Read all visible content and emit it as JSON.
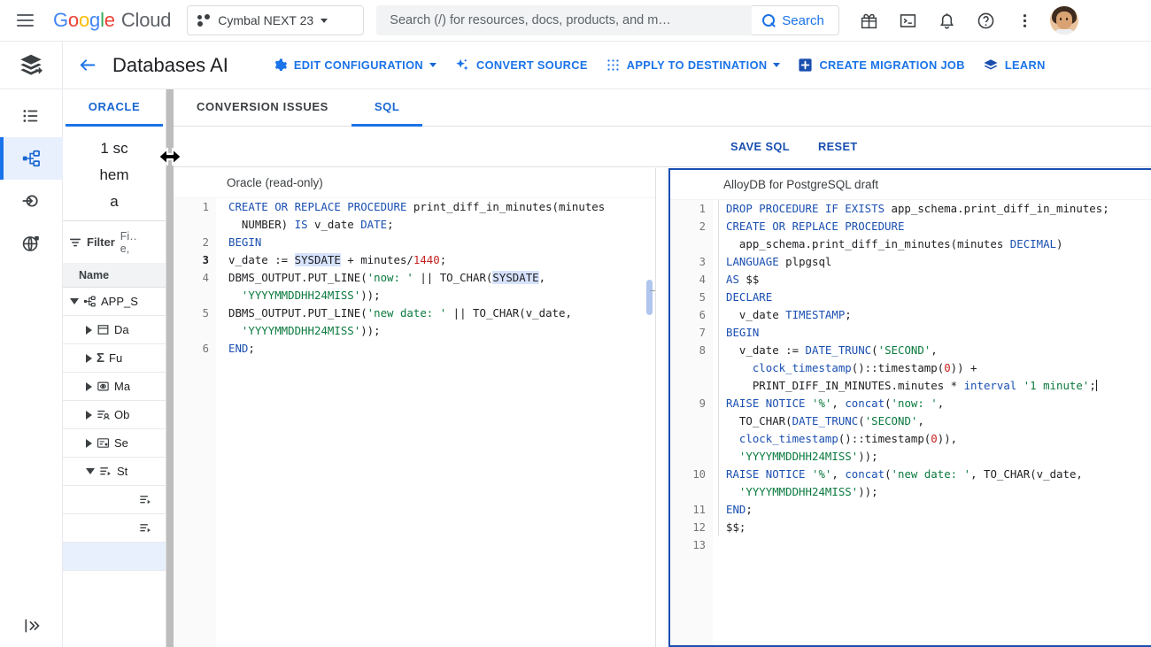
{
  "topbar": {
    "menu_icon": "hamburger-menu-icon",
    "brand": {
      "g": "G",
      "o1": "o",
      "o2": "o",
      "g2": "g",
      "l": "l",
      "e": "e",
      "cloud": "Cloud"
    },
    "project": {
      "label": "Cymbal NEXT 23",
      "icon": "project-dots-icon",
      "caret": "chevron-down-icon"
    },
    "search": {
      "placeholder": "Search (/) for resources, docs, products, and m…",
      "button_label": "Search",
      "icon": "search-icon"
    },
    "icons": [
      {
        "name": "gift-icon",
        "title": "Gift"
      },
      {
        "name": "cloud-shell-terminal-icon",
        "title": "Activate Cloud Shell"
      },
      {
        "name": "notifications-bell-icon",
        "title": "Notifications"
      },
      {
        "name": "help-question-icon",
        "title": "Help"
      },
      {
        "name": "more-vert-icon",
        "title": "More options"
      }
    ],
    "avatar": "user-avatar"
  },
  "pageheader": {
    "product_icon": "database-migration-stack-icon",
    "back_icon": "back-arrow-icon",
    "title": "Databases AI",
    "buttons": [
      {
        "label": "EDIT CONFIGURATION",
        "icon": "gear-icon",
        "caret": true
      },
      {
        "label": "CONVERT SOURCE",
        "icon": "sparkle-icon",
        "caret": false
      },
      {
        "label": "APPLY TO DESTINATION",
        "icon": "grid-dots-icon",
        "caret": true
      },
      {
        "label": "CREATE MIGRATION JOB",
        "icon": "plus-box-icon",
        "caret": false
      },
      {
        "label": "LEARN",
        "icon": "learn-stack-icon",
        "caret": false
      }
    ]
  },
  "rail": {
    "items": [
      {
        "name": "sidebar-item-list",
        "icon": "list-bullet-icon",
        "active": false
      },
      {
        "name": "sidebar-item-schema",
        "icon": "schema-tree-icon",
        "active": true
      },
      {
        "name": "sidebar-item-connection",
        "icon": "connection-arrow-icon",
        "active": false
      },
      {
        "name": "sidebar-item-global",
        "icon": "globe-icon",
        "active": false
      }
    ],
    "expand_icon": "expand-panel-icon"
  },
  "explorer": {
    "tab_label": "ORACLE",
    "schema_count": "1 schema",
    "filter_label": "Filter",
    "filter_placeholder": "Fi… e,",
    "column_header": "Name",
    "tree": [
      {
        "label": "APP_S",
        "icon": "schema-tree-icon",
        "twisty": "open",
        "indent": 0,
        "selected": false
      },
      {
        "label": "Da",
        "icon": "database-table-icon",
        "twisty": "closed",
        "indent": 1,
        "selected": false
      },
      {
        "label": "Fu",
        "icon": "sigma-function-icon",
        "twisty": "closed",
        "indent": 1,
        "selected": false
      },
      {
        "label": "Ma",
        "icon": "materialized-view-eye-icon",
        "twisty": "closed",
        "indent": 1,
        "selected": false
      },
      {
        "label": "Ob",
        "icon": "object-type-icon",
        "twisty": "closed",
        "indent": 1,
        "selected": false
      },
      {
        "label": "Se",
        "icon": "sequence-icon",
        "twisty": "closed",
        "indent": 1,
        "selected": false
      },
      {
        "label": "St",
        "icon": "stored-procedure-icon",
        "twisty": "open",
        "indent": 1,
        "selected": false
      },
      {
        "label": "",
        "icon": "stored-procedure-icon",
        "twisty": "none",
        "indent": 2,
        "selected": false
      },
      {
        "label": "",
        "icon": "stored-procedure-icon",
        "twisty": "none",
        "indent": 2,
        "selected": false
      },
      {
        "label": "",
        "icon": "none",
        "twisty": "none",
        "indent": 2,
        "selected": true
      }
    ]
  },
  "workspace": {
    "tabs": [
      {
        "label": "CONVERSION ISSUES",
        "active": false
      },
      {
        "label": "SQL",
        "active": true
      }
    ],
    "actions": [
      {
        "label": "SAVE SQL"
      },
      {
        "label": "RESET"
      }
    ]
  },
  "oracle_editor": {
    "header": "Oracle (read-only)",
    "lines": [
      {
        "n": "1",
        "bold": false,
        "html": "<span class='kw'>CREATE OR REPLACE PROCEDURE</span> print_diff_in_minutes(minutes\n  NUMBER) <span class='kw'>IS</span> v_date <span class='kw'>DATE</span>;"
      },
      {
        "n": "2",
        "bold": false,
        "html": "<span class='kw'>BEGIN</span>"
      },
      {
        "n": "3",
        "bold": true,
        "html": "v_date := <span class='hl'>SYSDATE</span> + minutes/<span class='num'>1440</span>;"
      },
      {
        "n": "4",
        "bold": false,
        "html": "DBMS_OUTPUT.PUT_LINE(<span class='str'>'now: '</span> || TO_CHAR(<span class='hl'>SYSDATE</span>,\n  <span class='str'>'YYYYMMDDHH24MISS'</span>));"
      },
      {
        "n": "5",
        "bold": false,
        "html": "DBMS_OUTPUT.PUT_LINE(<span class='str'>'new date: '</span> || TO_CHAR(v_date,\n  <span class='str'>'YYYYMMDDHH24MISS'</span>));"
      },
      {
        "n": "6",
        "bold": false,
        "html": "<span class='kw'>END</span>;"
      }
    ],
    "plain_text": "CREATE OR REPLACE PROCEDURE print_diff_in_minutes(minutes NUMBER) IS v_date DATE;\nBEGIN\nv_date := SYSDATE + minutes/1440;\nDBMS_OUTPUT.PUT_LINE('now: ' || TO_CHAR(SYSDATE, 'YYYYMMDDHH24MISS'));\nDBMS_OUTPUT.PUT_LINE('new date: ' || TO_CHAR(v_date, 'YYYYMMDDHH24MISS'));\nEND;"
  },
  "postgres_editor": {
    "header": "AlloyDB for PostgreSQL draft",
    "lines": [
      {
        "n": "1",
        "html": "<span class='kw'>DROP PROCEDURE IF EXISTS</span> app_schema.print_diff_in_minutes;"
      },
      {
        "n": "2",
        "html": "<span class='kw'>CREATE OR REPLACE PROCEDURE</span>\n  app_schema.print_diff_in_minutes(minutes <span class='kw'>DECIMAL</span>)"
      },
      {
        "n": "3",
        "html": "<span class='kw'>LANGUAGE</span> plpgsql"
      },
      {
        "n": "4",
        "html": "<span class='kw'>AS</span> $$"
      },
      {
        "n": "5",
        "html": "<span class='kw'>DECLARE</span>"
      },
      {
        "n": "6",
        "html": "  v_date <span class='kw'>TIMESTAMP</span>;"
      },
      {
        "n": "7",
        "html": "<span class='kw'>BEGIN</span>"
      },
      {
        "n": "8",
        "html": "  v_date := <span class='fn'>DATE_TRUNC</span>(<span class='str'>'SECOND'</span>,\n    <span class='fn'>clock_timestamp</span>()::timestamp(<span class='num'>0</span>)) +\n    PRINT_DIFF_IN_MINUTES.minutes * <span class='kw'>interval</span> <span class='str'>'1 minute'</span>;<span class='cursorbar'></span>"
      },
      {
        "n": "9",
        "html": "<span class='kw'>RAISE NOTICE</span> <span class='str'>'%'</span>, <span class='fn'>concat</span>(<span class='str'>'now: '</span>,\n  TO_CHAR(<span class='fn'>DATE_TRUNC</span>(<span class='str'>'SECOND'</span>,\n  <span class='fn'>clock_timestamp</span>()::timestamp(<span class='num'>0</span>)),\n  <span class='str'>'YYYYMMDDHH24MISS'</span>));"
      },
      {
        "n": "10",
        "html": "<span class='kw'>RAISE NOTICE</span> <span class='str'>'%'</span>, <span class='fn'>concat</span>(<span class='str'>'new date: '</span>, TO_CHAR(v_date,\n  <span class='str'>'YYYYMMDDHH24MISS'</span>));"
      },
      {
        "n": "11",
        "html": "<span class='kw'>END</span>;"
      },
      {
        "n": "12",
        "html": "$$;"
      },
      {
        "n": "13",
        "html": ""
      }
    ],
    "plain_text": "DROP PROCEDURE IF EXISTS app_schema.print_diff_in_minutes;\nCREATE OR REPLACE PROCEDURE app_schema.print_diff_in_minutes(minutes DECIMAL)\nLANGUAGE plpgsql\nAS $$\nDECLARE\n  v_date TIMESTAMP;\nBEGIN\n  v_date := DATE_TRUNC('SECOND', clock_timestamp()::timestamp(0)) + PRINT_DIFF_IN_MINUTES.minutes * interval '1 minute';\nRAISE NOTICE '%', concat('now: ', TO_CHAR(DATE_TRUNC('SECOND', clock_timestamp()::timestamp(0)), 'YYYYMMDDHH24MISS'));\nRAISE NOTICE '%', concat('new date: ', TO_CHAR(v_date, 'YYYYMMDDHH24MISS'));\nEND;\n$$;"
  },
  "colors": {
    "google_blue": "#1a73e8",
    "accent_dark_blue": "#1a4fb0",
    "active_bg": "#e8f0fe",
    "keyword": "#1a4fb0",
    "string": "#0b7a3e",
    "number": "#c5221f",
    "highlight": "#d7e3fc"
  }
}
